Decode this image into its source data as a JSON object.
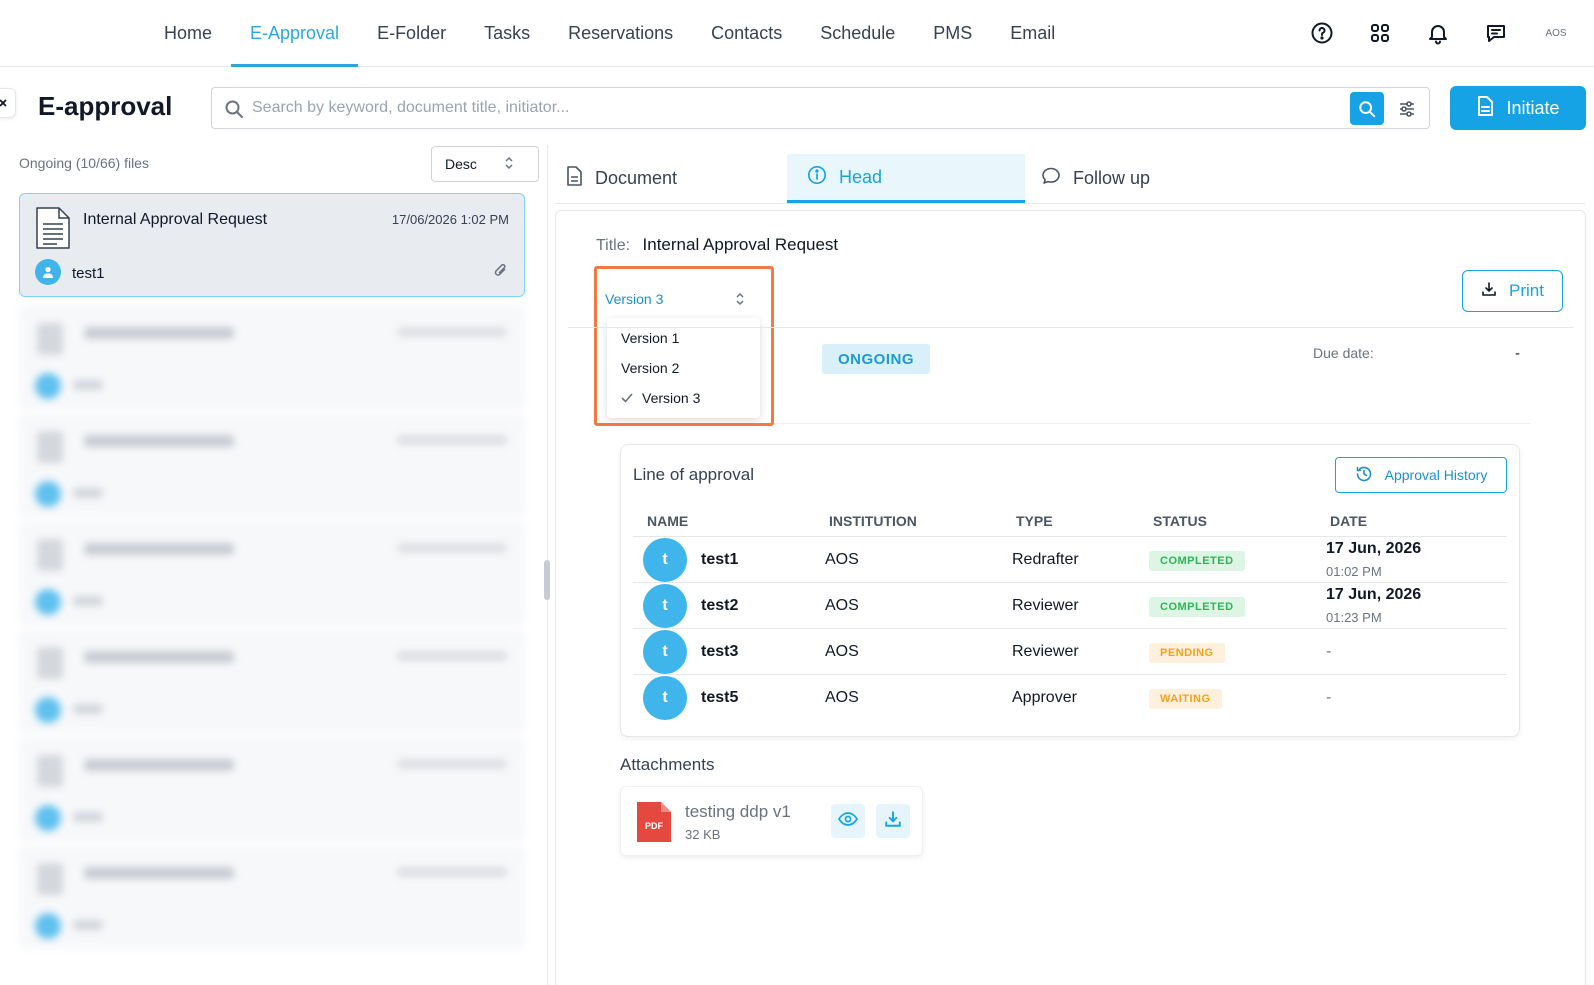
{
  "nav": {
    "items": [
      {
        "label": "Home",
        "active": false
      },
      {
        "label": "E-Approval",
        "active": true
      },
      {
        "label": "E-Folder",
        "active": false
      },
      {
        "label": "Tasks",
        "active": false
      },
      {
        "label": "Reservations",
        "active": false
      },
      {
        "label": "Contacts",
        "active": false
      },
      {
        "label": "Schedule",
        "active": false
      },
      {
        "label": "PMS",
        "active": false
      },
      {
        "label": "Email",
        "active": false
      }
    ],
    "icons": [
      "help-icon",
      "apps-grid-icon",
      "bell-icon",
      "chat-icon"
    ],
    "avatar_text": "AOS"
  },
  "header": {
    "title": "E-approval",
    "search_placeholder": "Search by keyword, document title, initiator...",
    "initiate_label": "Initiate"
  },
  "list": {
    "meta": "Ongoing (10/66) files",
    "sort_value": "Desc",
    "selected_item": {
      "title": "Internal Approval Request",
      "date": "17/06/2026 1:02 PM",
      "user": "test1"
    }
  },
  "tabs": [
    {
      "label": "Document",
      "icon": "document-icon",
      "active": false
    },
    {
      "label": "Head",
      "icon": "info-icon",
      "active": true
    },
    {
      "label": "Follow up",
      "icon": "comment-icon",
      "active": false
    }
  ],
  "detail": {
    "title_label": "Title:",
    "title_value": "Internal Approval Request",
    "version_selected": "Version 3",
    "version_options": [
      "Version 1",
      "Version 2",
      "Version 3"
    ],
    "print_label": "Print",
    "status": "ONGOING",
    "due_label": "Due date:",
    "due_value": "-"
  },
  "approval": {
    "heading": "Line of approval",
    "history_label": "Approval History",
    "columns": [
      "NAME",
      "INSTITUTION",
      "TYPE",
      "STATUS",
      "DATE"
    ],
    "rows": [
      {
        "initial": "t",
        "name": "test1",
        "institution": "AOS",
        "type": "Redrafter",
        "status": "COMPLETED",
        "date": "17 Jun, 2026",
        "time": "01:02 PM"
      },
      {
        "initial": "t",
        "name": "test2",
        "institution": "AOS",
        "type": "Reviewer",
        "status": "COMPLETED",
        "date": "17 Jun, 2026",
        "time": "01:23 PM"
      },
      {
        "initial": "t",
        "name": "test3",
        "institution": "AOS",
        "type": "Reviewer",
        "status": "PENDING",
        "date": "-",
        "time": ""
      },
      {
        "initial": "t",
        "name": "test5",
        "institution": "AOS",
        "type": "Approver",
        "status": "WAITING",
        "date": "-",
        "time": ""
      }
    ]
  },
  "attachments": {
    "heading": "Attachments",
    "files": [
      {
        "name": "testing ddp v1",
        "size": "32 KB",
        "type_label": "PDF"
      }
    ]
  },
  "colors": {
    "accent": "#16a3e6",
    "highlight": "#f07a3f",
    "completed": "#2fb457",
    "pending": "#f2a21b"
  }
}
